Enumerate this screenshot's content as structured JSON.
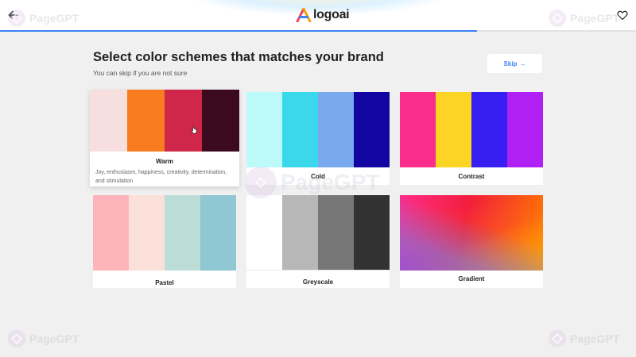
{
  "header": {
    "logo_text": "logoai",
    "progress_percent": 75,
    "watermark_text": "PageGPT"
  },
  "page": {
    "title": "Select color schemes that matches your brand",
    "subtitle": "You can skip if you are not sure",
    "skip_label": "Skip",
    "skip_arrow": "→"
  },
  "schemes": [
    {
      "name": "Warm",
      "description": "Joy, enthusiasm, happiness, creativity, determination, and stimulation",
      "colors": [
        "#f7dfdf",
        "#f97d20",
        "#cf2649",
        "#3c0a1e"
      ]
    },
    {
      "name": "Cold",
      "colors": [
        "#bcfafa",
        "#3ad8ea",
        "#7aaaee",
        "#1206a3"
      ]
    },
    {
      "name": "Contrast",
      "colors": [
        "#fb2d8c",
        "#fcd423",
        "#371ff2",
        "#b020f5"
      ]
    },
    {
      "name": "Pastel",
      "colors": [
        "#fdb5bb",
        "#fbe0da",
        "#bcdcd7",
        "#8fc7d3"
      ]
    },
    {
      "name": "Greyscale",
      "colors": [
        "#ffffff",
        "#b7b7b7",
        "#777777",
        "#323232"
      ]
    },
    {
      "name": "Gradient",
      "colors": [
        "#ff2d8a",
        "#f31d3c",
        "#ff7a00",
        "#6b6fff"
      ]
    }
  ]
}
